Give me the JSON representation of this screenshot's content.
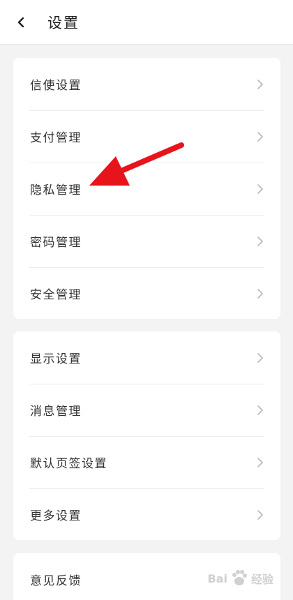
{
  "header": {
    "title": "设置",
    "back_icon": "chevron-left-icon"
  },
  "groups": [
    {
      "items": [
        {
          "label": "信使设置"
        },
        {
          "label": "支付管理"
        },
        {
          "label": "隐私管理"
        },
        {
          "label": "密码管理"
        },
        {
          "label": "安全管理"
        }
      ]
    },
    {
      "items": [
        {
          "label": "显示设置"
        },
        {
          "label": "消息管理"
        },
        {
          "label": "默认页签设置"
        },
        {
          "label": "更多设置"
        }
      ]
    },
    {
      "items": [
        {
          "label": "意见反馈"
        }
      ]
    }
  ],
  "annotation": {
    "arrow_color": "#e8141b",
    "target": "隐私管理"
  },
  "watermark": {
    "text_left": "Bai",
    "text_right": "经验"
  }
}
